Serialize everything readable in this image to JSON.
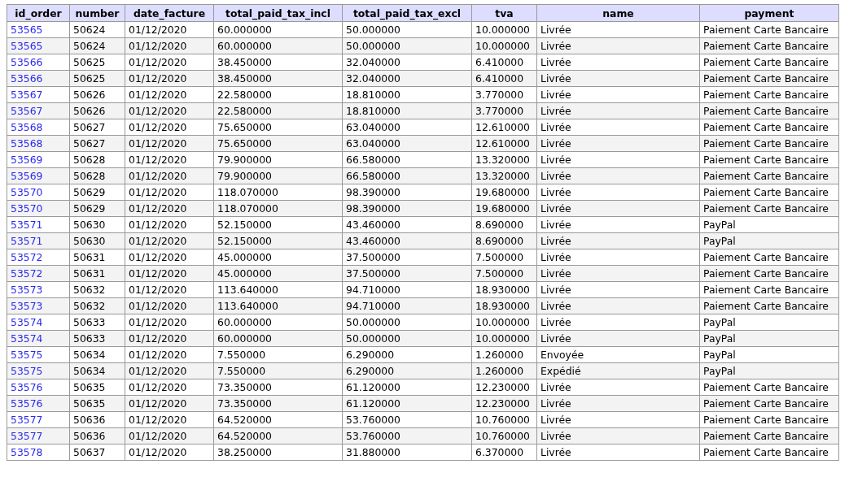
{
  "table": {
    "columns": [
      "id_order",
      "number",
      "date_facture",
      "total_paid_tax_incl",
      "total_paid_tax_excl",
      "tva",
      "name",
      "payment"
    ],
    "rows": [
      [
        "53565",
        "50624",
        "01/12/2020",
        "60.000000",
        "50.000000",
        "10.000000",
        "Livrée",
        "Paiement Carte Bancaire"
      ],
      [
        "53565",
        "50624",
        "01/12/2020",
        "60.000000",
        "50.000000",
        "10.000000",
        "Livrée",
        "Paiement Carte Bancaire"
      ],
      [
        "53566",
        "50625",
        "01/12/2020",
        "38.450000",
        "32.040000",
        "6.410000",
        "Livrée",
        "Paiement Carte Bancaire"
      ],
      [
        "53566",
        "50625",
        "01/12/2020",
        "38.450000",
        "32.040000",
        "6.410000",
        "Livrée",
        "Paiement Carte Bancaire"
      ],
      [
        "53567",
        "50626",
        "01/12/2020",
        "22.580000",
        "18.810000",
        "3.770000",
        "Livrée",
        "Paiement Carte Bancaire"
      ],
      [
        "53567",
        "50626",
        "01/12/2020",
        "22.580000",
        "18.810000",
        "3.770000",
        "Livrée",
        "Paiement Carte Bancaire"
      ],
      [
        "53568",
        "50627",
        "01/12/2020",
        "75.650000",
        "63.040000",
        "12.610000",
        "Livrée",
        "Paiement Carte Bancaire"
      ],
      [
        "53568",
        "50627",
        "01/12/2020",
        "75.650000",
        "63.040000",
        "12.610000",
        "Livrée",
        "Paiement Carte Bancaire"
      ],
      [
        "53569",
        "50628",
        "01/12/2020",
        "79.900000",
        "66.580000",
        "13.320000",
        "Livrée",
        "Paiement Carte Bancaire"
      ],
      [
        "53569",
        "50628",
        "01/12/2020",
        "79.900000",
        "66.580000",
        "13.320000",
        "Livrée",
        "Paiement Carte Bancaire"
      ],
      [
        "53570",
        "50629",
        "01/12/2020",
        "118.070000",
        "98.390000",
        "19.680000",
        "Livrée",
        "Paiement Carte Bancaire"
      ],
      [
        "53570",
        "50629",
        "01/12/2020",
        "118.070000",
        "98.390000",
        "19.680000",
        "Livrée",
        "Paiement Carte Bancaire"
      ],
      [
        "53571",
        "50630",
        "01/12/2020",
        "52.150000",
        "43.460000",
        "8.690000",
        "Livrée",
        "PayPal"
      ],
      [
        "53571",
        "50630",
        "01/12/2020",
        "52.150000",
        "43.460000",
        "8.690000",
        "Livrée",
        "PayPal"
      ],
      [
        "53572",
        "50631",
        "01/12/2020",
        "45.000000",
        "37.500000",
        "7.500000",
        "Livrée",
        "Paiement Carte Bancaire"
      ],
      [
        "53572",
        "50631",
        "01/12/2020",
        "45.000000",
        "37.500000",
        "7.500000",
        "Livrée",
        "Paiement Carte Bancaire"
      ],
      [
        "53573",
        "50632",
        "01/12/2020",
        "113.640000",
        "94.710000",
        "18.930000",
        "Livrée",
        "Paiement Carte Bancaire"
      ],
      [
        "53573",
        "50632",
        "01/12/2020",
        "113.640000",
        "94.710000",
        "18.930000",
        "Livrée",
        "Paiement Carte Bancaire"
      ],
      [
        "53574",
        "50633",
        "01/12/2020",
        "60.000000",
        "50.000000",
        "10.000000",
        "Livrée",
        "PayPal"
      ],
      [
        "53574",
        "50633",
        "01/12/2020",
        "60.000000",
        "50.000000",
        "10.000000",
        "Livrée",
        "PayPal"
      ],
      [
        "53575",
        "50634",
        "01/12/2020",
        "7.550000",
        "6.290000",
        "1.260000",
        "Envoyée",
        "PayPal"
      ],
      [
        "53575",
        "50634",
        "01/12/2020",
        "7.550000",
        "6.290000",
        "1.260000",
        "Expédié",
        "PayPal"
      ],
      [
        "53576",
        "50635",
        "01/12/2020",
        "73.350000",
        "61.120000",
        "12.230000",
        "Livrée",
        "Paiement Carte Bancaire"
      ],
      [
        "53576",
        "50635",
        "01/12/2020",
        "73.350000",
        "61.120000",
        "12.230000",
        "Livrée",
        "Paiement Carte Bancaire"
      ],
      [
        "53577",
        "50636",
        "01/12/2020",
        "64.520000",
        "53.760000",
        "10.760000",
        "Livrée",
        "Paiement Carte Bancaire"
      ],
      [
        "53577",
        "50636",
        "01/12/2020",
        "64.520000",
        "53.760000",
        "10.760000",
        "Livrée",
        "Paiement Carte Bancaire"
      ],
      [
        "53578",
        "50637",
        "01/12/2020",
        "38.250000",
        "31.880000",
        "6.370000",
        "Livrée",
        "Paiement Carte Bancaire"
      ]
    ]
  }
}
